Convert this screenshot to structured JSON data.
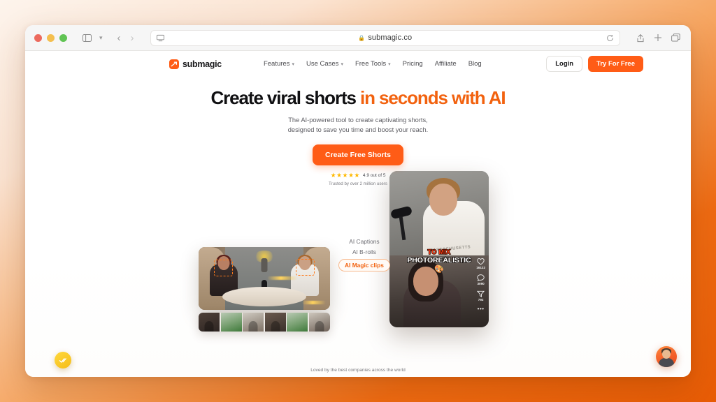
{
  "browser": {
    "url": "submagic.co",
    "lock_icon": "lock-icon",
    "sidebar_icon": "sidebar-toggle-icon",
    "back_icon": "back-arrow-icon",
    "forward_icon": "forward-arrow-icon",
    "reload_icon": "reload-icon",
    "reader_icon": "reader-view-icon",
    "share_icon": "share-icon",
    "newtab_icon": "plus-icon",
    "tabs_icon": "tab-overview-icon",
    "traffic": [
      "close",
      "minimize",
      "maximize"
    ]
  },
  "site": {
    "logo_text": "submagic",
    "nav": [
      {
        "label": "Features",
        "caret": "∨"
      },
      {
        "label": "Use Cases",
        "caret": "∨"
      },
      {
        "label": "Free Tools",
        "caret": "∨"
      },
      {
        "label": "Pricing",
        "caret": ""
      },
      {
        "label": "Affiliate",
        "caret": ""
      },
      {
        "label": "Blog",
        "caret": ""
      }
    ],
    "login_label": "Login",
    "try_label": "Try For Free"
  },
  "hero": {
    "title_black": "Create viral shorts",
    "title_accent": "in seconds with AI",
    "sub_line1": "The AI-powered tool to create captivating shorts,",
    "sub_line2": "designed to save you time and boost your reach.",
    "cta_label": "Create Free Shorts",
    "stars": "★★★★★",
    "rating_text": "4.9 out of 5",
    "trusted_text": "Trusted by over 2 million users"
  },
  "showcase": {
    "labels": [
      {
        "text": "AI Captions",
        "active": false
      },
      {
        "text": "AI B-rolls",
        "active": false
      },
      {
        "text": "AI Magic clips",
        "active": true
      }
    ],
    "video_caption": {
      "top_line": "TO MIX",
      "main_line": "PHOTOREALISTIC",
      "emoji": "🎨"
    },
    "shirt_text": "MASSACHUSETTS",
    "social": [
      {
        "icon": "heart-icon",
        "count": "16122"
      },
      {
        "icon": "comment-icon",
        "count": "3090"
      },
      {
        "icon": "share-icon",
        "count": "792"
      }
    ],
    "more_icon": "•••"
  },
  "footer": {
    "note": "Loved by the best companies across the world"
  },
  "widgets": {
    "left_badge": "check-badge-icon",
    "right_avatar": "support-avatar"
  },
  "colors": {
    "brand_orange": "#ff5c16",
    "accent_text": "#f2620f",
    "star_yellow": "#ffb800",
    "page_bg_start": "#fdf4ec",
    "page_bg_end": "#e85c05"
  }
}
